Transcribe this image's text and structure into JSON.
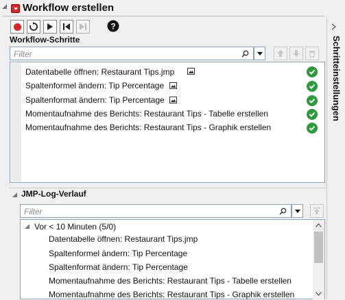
{
  "title": "Workflow erstellen",
  "toolbar": {
    "record_icon": "record-icon",
    "reset_icon": "reset-icon",
    "play_icon": "play-icon",
    "step_back_icon": "step-back-icon",
    "step_forward_icon": "step-forward-icon",
    "help_icon": "help-icon"
  },
  "steps_section": {
    "label": "Workflow-Schritte",
    "filter_placeholder": "Filter"
  },
  "steps": [
    {
      "label": "Datentabelle öffnen: Restaurant Tips.jmp",
      "has_image_icon": true,
      "status": "done"
    },
    {
      "label": "Spaltenformel ändern: Tip Percentage",
      "has_image_icon": true,
      "status": "done"
    },
    {
      "label": "Spaltenformat ändern: Tip Percentage",
      "has_image_icon": true,
      "status": "done"
    },
    {
      "label": "Momentaufnahme des Berichts: Restaurant Tips - Tabelle erstellen",
      "has_image_icon": false,
      "status": "done"
    },
    {
      "label": "Momentaufnahme des Berichts: Restaurant Tips - Graphik erstellen",
      "has_image_icon": false,
      "status": "done"
    }
  ],
  "log_section": {
    "label": "JMP-Log-Verlauf",
    "filter_placeholder": "Filter",
    "group_label": "Vor < 10 Minuten (5/0)",
    "items": [
      "Datentabelle öffnen: Restaurant Tips.jmp",
      "Spaltenformel ändern: Tip Percentage",
      "Spaltenformat ändern: Tip Percentage",
      "Momentaufnahme des Berichts: Restaurant Tips - Tabelle erstellen",
      "Momentaufnahme des Berichts: Restaurant Tips - Graphik erstellen"
    ]
  },
  "side_panel": {
    "label": "Schritteinstellungen"
  },
  "colors": {
    "red_button": "#d6262b",
    "check_green": "#2e9a3c",
    "input_border": "#8aa2c0"
  }
}
